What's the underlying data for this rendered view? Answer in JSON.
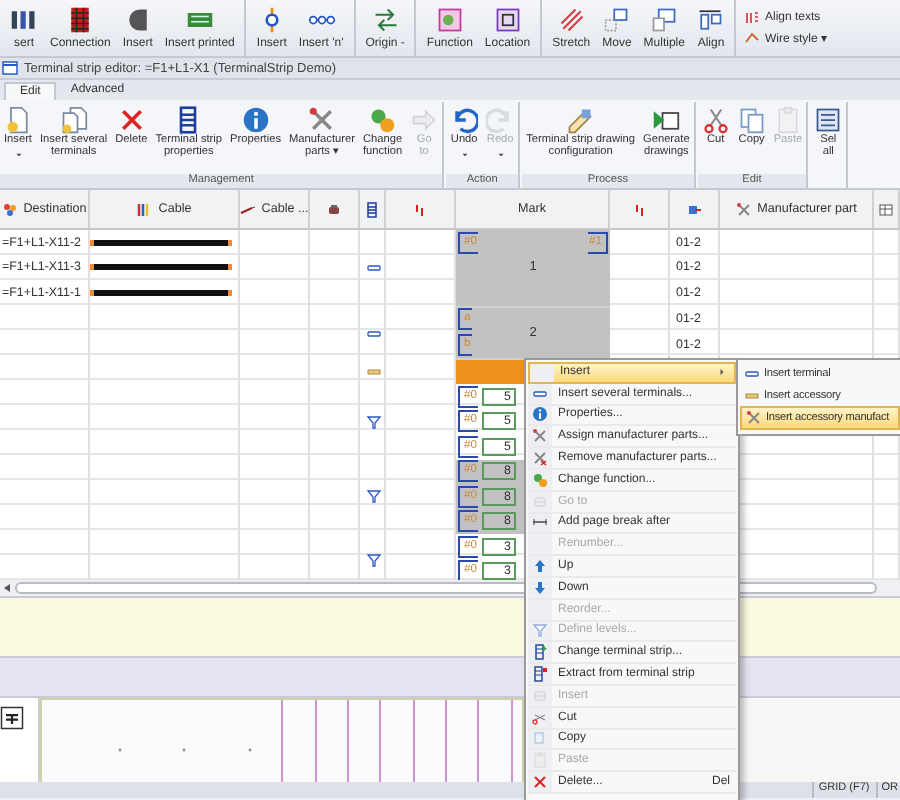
{
  "toolbar": {
    "groups": [
      {
        "buttons": [
          "sert",
          "Connection",
          "Insert",
          "Insert printed"
        ]
      },
      {
        "buttons": [
          "Insert",
          "Insert 'n'"
        ]
      },
      {
        "buttons": [
          "Origin -"
        ]
      },
      {
        "buttons": [
          "Function",
          "Location"
        ]
      },
      {
        "buttons": [
          "Stretch",
          "Move",
          "Multiple",
          "Align"
        ]
      }
    ],
    "small_buttons": [
      "Align texts",
      "Wire style ▾"
    ]
  },
  "window": {
    "title": "Terminal strip editor: =F1+L1-X1 (TerminalStrip Demo)"
  },
  "tabs": [
    {
      "label": "Edit",
      "selected": true
    },
    {
      "label": "Advanced",
      "selected": false
    }
  ],
  "ribbon": {
    "groups": [
      {
        "title": "Management",
        "buttons": [
          {
            "label": "Insert",
            "dropdown": true,
            "disabled": false
          },
          {
            "label": "Insert several\nterminals",
            "dropdown": false,
            "disabled": false
          },
          {
            "label": "Delete",
            "dropdown": false,
            "disabled": false
          },
          {
            "label": "Terminal strip\nproperties",
            "dropdown": false,
            "disabled": false
          },
          {
            "label": "Properties",
            "dropdown": false,
            "disabled": false
          },
          {
            "label": "Manufacturer\nparts ▾",
            "dropdown": false,
            "disabled": false
          },
          {
            "label": "Change\nfunction",
            "dropdown": false,
            "disabled": false
          },
          {
            "label": "Go\nto",
            "dropdown": false,
            "disabled": true
          }
        ]
      },
      {
        "title": "Action",
        "buttons": [
          {
            "label": "Undo",
            "dropdown": true,
            "disabled": false
          },
          {
            "label": "Redo",
            "dropdown": true,
            "disabled": true
          }
        ]
      },
      {
        "title": "Process",
        "buttons": [
          {
            "label": "Terminal strip drawing\nconfiguration",
            "dropdown": false,
            "disabled": false
          },
          {
            "label": "Generate\ndrawings",
            "dropdown": false,
            "disabled": false
          }
        ]
      },
      {
        "title": "Edit",
        "buttons": [
          {
            "label": "Cut",
            "dropdown": false,
            "disabled": false
          },
          {
            "label": "Copy",
            "dropdown": false,
            "disabled": false
          },
          {
            "label": "Paste",
            "dropdown": false,
            "disabled": true
          }
        ]
      },
      {
        "buttons": [
          {
            "label": "Sel\nall",
            "dropdown": false,
            "disabled": false
          }
        ]
      }
    ]
  },
  "table": {
    "columns": [
      {
        "kind": "text",
        "label": "Destination"
      },
      {
        "kind": "text",
        "label": "Cable"
      },
      {
        "kind": "text",
        "label": "Cable ..."
      },
      {
        "kind": "icon"
      },
      {
        "kind": "icon"
      },
      {
        "kind": "icon"
      },
      {
        "kind": "text",
        "label": "Mark"
      },
      {
        "kind": "icon"
      },
      {
        "kind": "icon"
      },
      {
        "kind": "text",
        "label": "Manufacturer part"
      },
      {
        "kind": "icon"
      }
    ],
    "terminals": [
      {
        "kind": "terminal",
        "selected": true,
        "number": "1",
        "rows": [
          {
            "destination": "=F1+L1-X11-2",
            "cable": true,
            "mark": "#0",
            "mark_right": "#1",
            "page": "01-2"
          },
          {
            "destination": "=F1+L1-X11-3",
            "cable": true,
            "page": "01-2"
          },
          {
            "destination": "=F1+L1-X11-1",
            "cable": true,
            "page": "01-2"
          }
        ]
      },
      {
        "kind": "terminal",
        "selected": true,
        "number": "2",
        "rows": [
          {
            "cable": false,
            "mark": "a",
            "page": "01-2"
          },
          {
            "cable": false,
            "mark": "b",
            "page": "01-2"
          }
        ]
      },
      {
        "kind": "accessory",
        "selected": false,
        "rows": [
          {
            "cable": false
          }
        ]
      },
      {
        "kind": "multilevel",
        "selected": false,
        "rows": [
          {
            "cable": false,
            "mark": "#0",
            "number": "5"
          },
          {
            "cable": false,
            "mark": "#0",
            "number": "5"
          },
          {
            "cable": false,
            "mark": "#0",
            "number": "5"
          }
        ]
      },
      {
        "kind": "multilevel",
        "selected": true,
        "rows": [
          {
            "cable": false,
            "mark": "#0",
            "number": "8"
          },
          {
            "cable": false,
            "mark": "#0",
            "number": "8"
          },
          {
            "cable": false,
            "mark": "#0",
            "number": "8"
          }
        ]
      },
      {
        "kind": "multilevel",
        "selected": false,
        "rows": [
          {
            "cable": false,
            "mark": "#0",
            "number": "3"
          },
          {
            "cable": false,
            "mark": "#0",
            "number": "3"
          }
        ]
      }
    ]
  },
  "context_menu": {
    "items": [
      {
        "label": "Insert",
        "has_submenu": true,
        "selected": true,
        "disabled": false
      },
      {
        "label": "Insert several terminals...",
        "has_submenu": false,
        "selected": false,
        "disabled": false
      },
      {
        "label": "Properties...",
        "has_submenu": false,
        "selected": false,
        "disabled": false
      },
      {
        "label": "Assign manufacturer parts...",
        "has_submenu": false,
        "selected": false,
        "disabled": false
      },
      {
        "label": "Remove manufacturer parts...",
        "has_submenu": false,
        "selected": false,
        "disabled": false
      },
      {
        "label": "Change function...",
        "has_submenu": false,
        "selected": false,
        "disabled": false
      },
      {
        "label": "Go to",
        "has_submenu": false,
        "selected": false,
        "disabled": true
      },
      {
        "label": "Add page break after",
        "has_submenu": false,
        "selected": false,
        "disabled": false
      },
      {
        "label": "Renumber...",
        "has_submenu": false,
        "selected": false,
        "disabled": true
      },
      {
        "label": "Up",
        "has_submenu": false,
        "selected": false,
        "disabled": false
      },
      {
        "label": "Down",
        "has_submenu": false,
        "selected": false,
        "disabled": false
      },
      {
        "label": "Reorder...",
        "has_submenu": false,
        "selected": false,
        "disabled": true
      },
      {
        "label": "Define levels...",
        "has_submenu": false,
        "selected": false,
        "disabled": true
      },
      {
        "label": "Change terminal strip...",
        "has_submenu": false,
        "selected": false,
        "disabled": false
      },
      {
        "label": "Extract from terminal strip",
        "has_submenu": false,
        "selected": false,
        "disabled": false
      },
      {
        "label": "Insert",
        "has_submenu": false,
        "selected": false,
        "disabled": true
      },
      {
        "label": "Cut",
        "has_submenu": false,
        "selected": false,
        "disabled": false
      },
      {
        "label": "Copy",
        "has_submenu": false,
        "selected": false,
        "disabled": false
      },
      {
        "label": "Paste",
        "has_submenu": false,
        "selected": false,
        "disabled": true
      },
      {
        "label": "Delete...",
        "shortcut": "Del",
        "has_submenu": false,
        "selected": false,
        "disabled": false
      }
    ],
    "submenu": {
      "items": [
        {
          "label": "Insert terminal",
          "selected": false
        },
        {
          "label": "Insert accessory",
          "selected": false
        },
        {
          "label": "Insert accessory manufact",
          "selected": true
        }
      ]
    }
  },
  "status_bar": [
    "GRID (F7)",
    "OR"
  ]
}
